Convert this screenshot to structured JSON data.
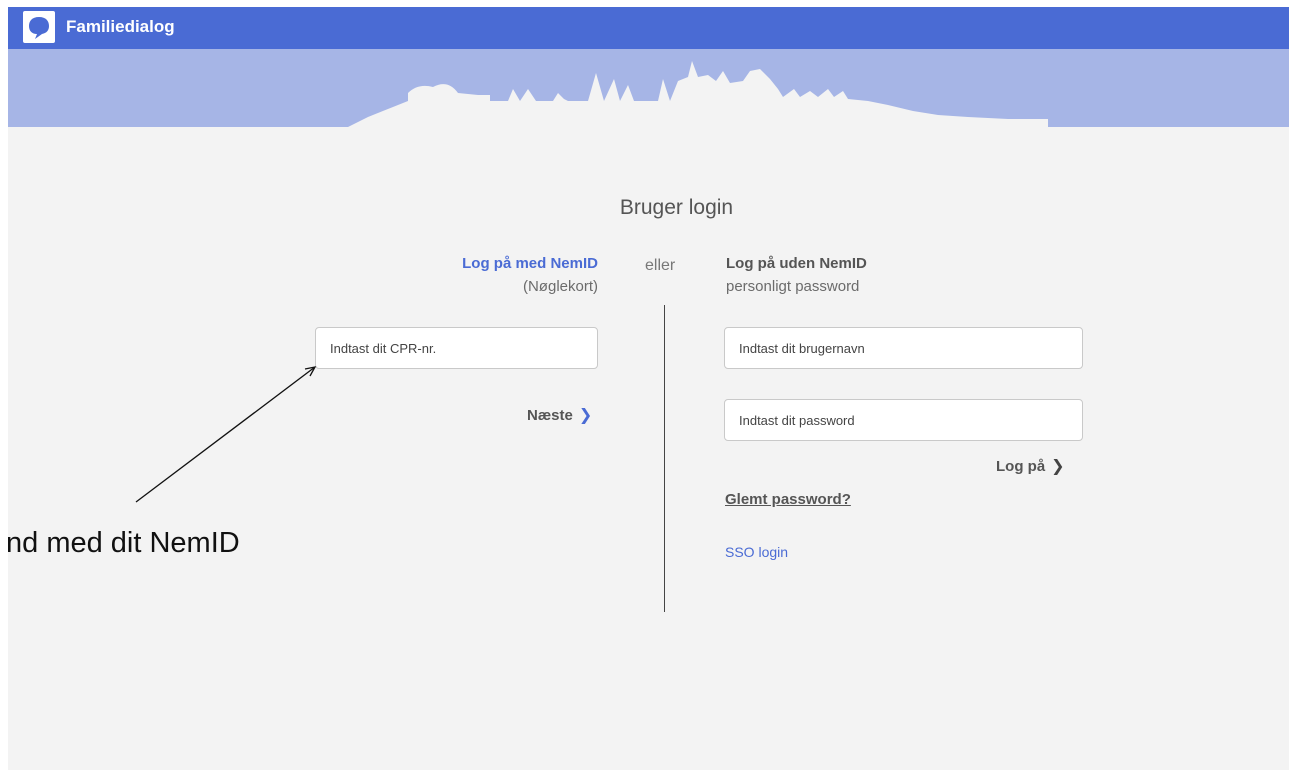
{
  "app": {
    "title": "Familiedialog"
  },
  "page": {
    "title": "Bruger login"
  },
  "nemid": {
    "heading": "Log på med NemID",
    "subheading": "(Nøglekort)",
    "cpr_placeholder": "Indtast dit CPR-nr.",
    "next_label": "Næste"
  },
  "separator": {
    "label": "eller"
  },
  "password_login": {
    "heading": "Log på uden NemID",
    "subheading": "personligt password",
    "username_placeholder": "Indtast dit brugernavn",
    "password_placeholder": "Indtast dit password",
    "login_label": "Log på",
    "forgot_label": "Glemt password?",
    "sso_label": "SSO login"
  },
  "annotation": {
    "text": "nd med dit NemID"
  },
  "colors": {
    "brand": "#4a6bd4",
    "banner": "#a6b5e6",
    "background": "#f3f3f3"
  },
  "icons": {
    "logo": "speech-bubble-logo-icon",
    "chevron": "chevron-right-icon"
  }
}
